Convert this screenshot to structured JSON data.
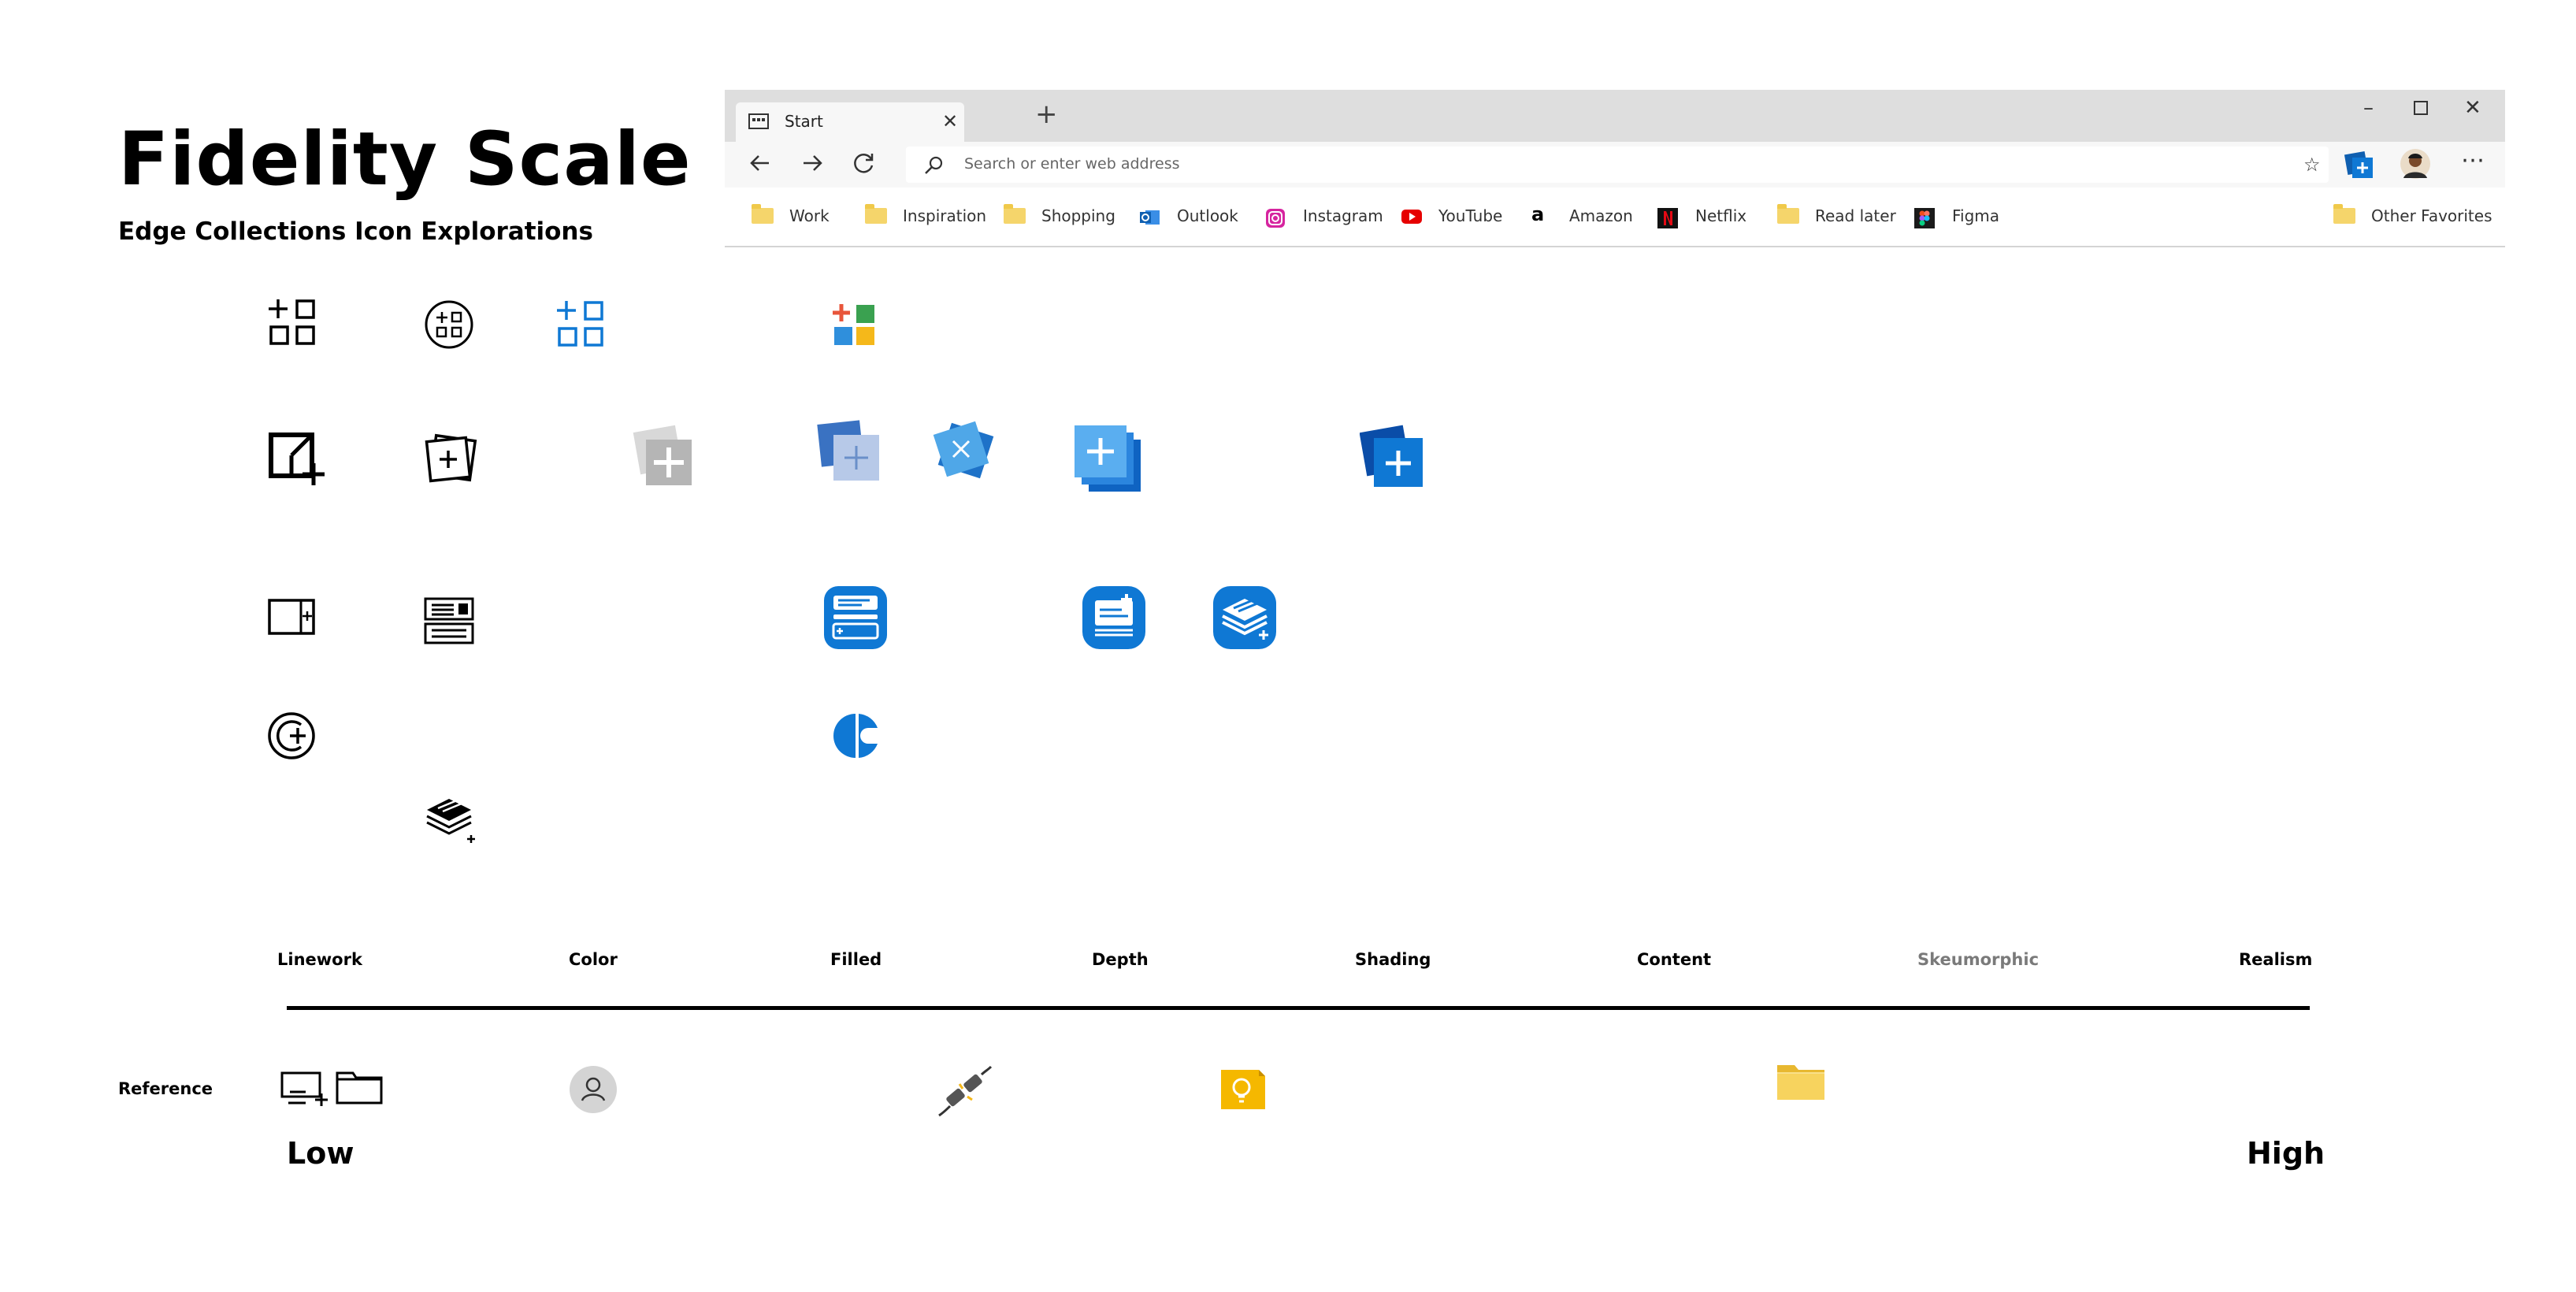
{
  "header": {
    "title": "Fidelity Scale",
    "subtitle": "Edge Collections Icon Explorations"
  },
  "browser": {
    "tab_title": "Start",
    "address_placeholder": "Search or enter web address",
    "favorites": [
      {
        "label": "Work",
        "icon": "folder-icon"
      },
      {
        "label": "Inspiration",
        "icon": "folder-icon"
      },
      {
        "label": "Shopping",
        "icon": "folder-icon"
      },
      {
        "label": "Outlook",
        "icon": "outlook-icon"
      },
      {
        "label": "Instagram",
        "icon": "instagram-icon"
      },
      {
        "label": "YouTube",
        "icon": "youtube-icon"
      },
      {
        "label": "Amazon",
        "icon": "amazon-icon"
      },
      {
        "label": "Netflix",
        "icon": "netflix-icon"
      },
      {
        "label": "Read later",
        "icon": "folder-icon"
      },
      {
        "label": "Figma",
        "icon": "figma-icon"
      }
    ],
    "other_favorites": "Other Favorites"
  },
  "scale": {
    "labels": [
      "Linework",
      "Color",
      "Filled",
      "Depth",
      "Shading",
      "Content",
      "Skeumorphic",
      "Realism"
    ],
    "reference_label": "Reference",
    "low": "Low",
    "high": "High"
  },
  "colors": {
    "accent_blue": "#0f78d4",
    "light_blue": "#4fa7e8",
    "folder_yellow": "#f5d56b",
    "skeumorphic_label": "#7a7a7a"
  }
}
